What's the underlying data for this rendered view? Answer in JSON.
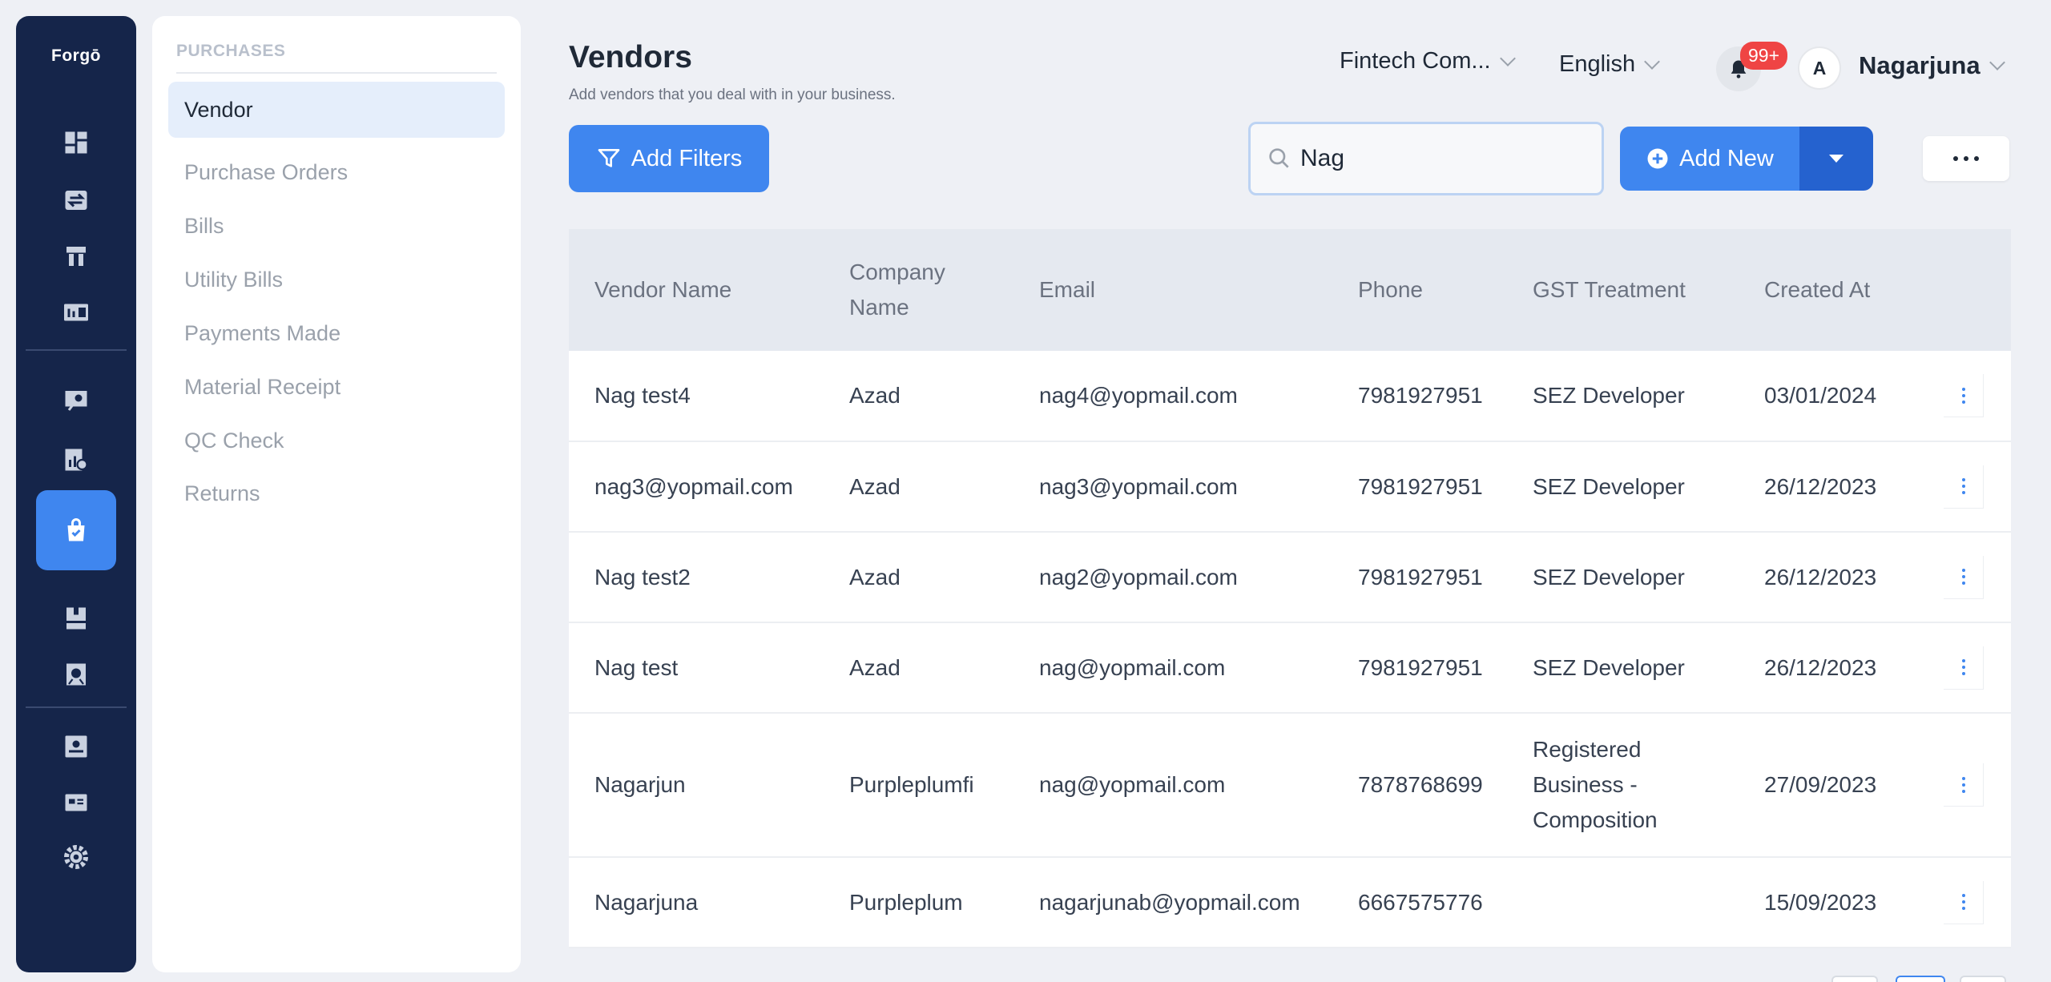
{
  "app": {
    "logo": "Forgō"
  },
  "rail": {
    "icons": [
      "dashboard-icon",
      "transfer-icon",
      "inventory-icon",
      "reports-icon",
      "accountant-icon",
      "analytics-icon",
      "purchases-icon",
      "sales-icon",
      "banking-icon",
      "contacts-icon",
      "documents-icon",
      "settings-icon"
    ],
    "active": "purchases-icon",
    "accent_color": "#3f86ef",
    "background_color": "#15254a"
  },
  "subnav": {
    "heading": "PURCHASES",
    "items": [
      {
        "label": "Vendor",
        "active": true
      },
      {
        "label": "Purchase Orders"
      },
      {
        "label": "Bills"
      },
      {
        "label": "Utility Bills"
      },
      {
        "label": "Payments Made"
      },
      {
        "label": "Material Receipt"
      },
      {
        "label": "QC Check"
      },
      {
        "label": "Returns"
      }
    ]
  },
  "header": {
    "title": "Vendors",
    "subtitle": "Add vendors that you deal with in your business.",
    "company": "Fintech Com...",
    "language": "English",
    "notifications": "99+",
    "avatar_initial": "A",
    "user_name": "Nagarjuna"
  },
  "toolbar": {
    "filter_label": "Add Filters",
    "search_value": "Nag",
    "add_label": "Add New"
  },
  "table": {
    "columns": [
      "Vendor Name",
      "Company Name",
      "Email",
      "Phone",
      "GST Treatment",
      "Created At"
    ],
    "rows": [
      {
        "vendor": "Nag test4",
        "company": "Azad",
        "email": "nag4@yopmail.com",
        "phone": "7981927951",
        "gst": "SEZ Developer",
        "created": "03/01/2024"
      },
      {
        "vendor": "nag3@yopmail.com",
        "company": "Azad",
        "email": "nag3@yopmail.com",
        "phone": "7981927951",
        "gst": "SEZ Developer",
        "created": "26/12/2023"
      },
      {
        "vendor": "Nag test2",
        "company": "Azad",
        "email": "nag2@yopmail.com",
        "phone": "7981927951",
        "gst": "SEZ Developer",
        "created": "26/12/2023"
      },
      {
        "vendor": "Nag test",
        "company": "Azad",
        "email": "nag@yopmail.com",
        "phone": "7981927951",
        "gst": "SEZ Developer",
        "created": "26/12/2023"
      },
      {
        "vendor": "Nagarjun",
        "company": "Purpleplumfi",
        "email": "nag@yopmail.com",
        "phone": "7878768699",
        "gst": "Registered Business - Composition",
        "created": "27/09/2023"
      },
      {
        "vendor": "Nagarjuna",
        "company": "Purpleplum",
        "email": "nagarjunab@yopmail.com",
        "phone": "6667575776",
        "gst": "",
        "created": "15/09/2023"
      }
    ]
  }
}
